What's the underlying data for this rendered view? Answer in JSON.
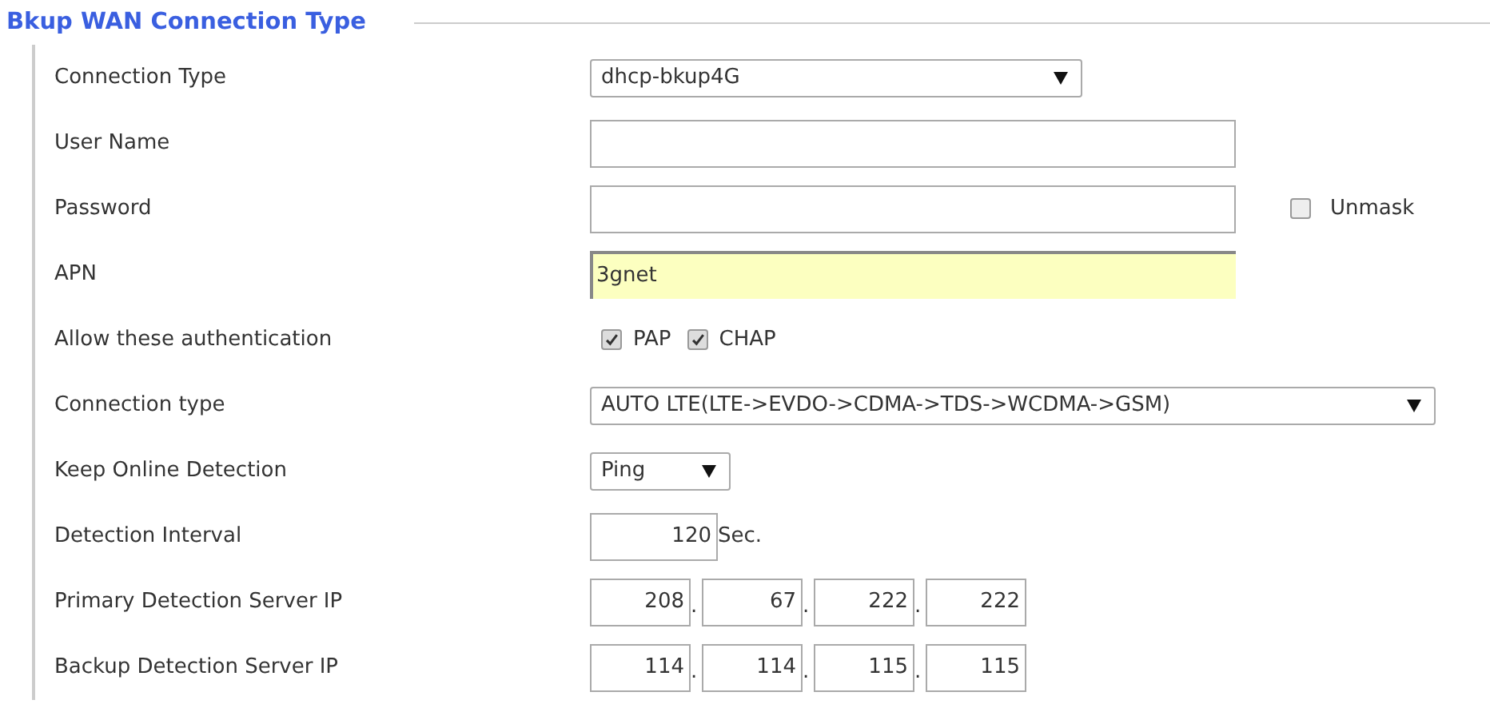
{
  "section": {
    "title": "Bkup WAN Connection Type"
  },
  "rows": [
    {
      "label": "Connection Type",
      "kind": "select",
      "value": "dhcp-bkup4G"
    },
    {
      "label": "User Name",
      "kind": "text",
      "value": "",
      "highlighted": false
    },
    {
      "label": "Password",
      "kind": "password",
      "value": "",
      "unmask": {
        "label": "Unmask",
        "checked": false
      }
    },
    {
      "label": "APN",
      "kind": "text",
      "value": "3gnet",
      "highlighted": true
    },
    {
      "label": "Allow these authentication",
      "kind": "checks",
      "options": [
        {
          "label": "PAP",
          "checked": true
        },
        {
          "label": "CHAP",
          "checked": true
        }
      ]
    },
    {
      "label": "Connection type",
      "kind": "select",
      "value": "AUTO LTE(LTE->EVDO->CDMA->TDS->WCDMA->GSM)"
    },
    {
      "label": "Keep Online Detection",
      "kind": "select",
      "value": "Ping"
    },
    {
      "label": "Detection Interval",
      "kind": "interval",
      "value": "120",
      "unit": "Sec."
    },
    {
      "label": "Primary Detection Server IP",
      "kind": "ip",
      "octets": [
        "208",
        "67",
        "222",
        "222"
      ],
      "separator": "."
    },
    {
      "label": "Backup Detection Server IP",
      "kind": "ip",
      "octets": [
        "114",
        "114",
        "115",
        "115"
      ],
      "separator": "."
    }
  ]
}
